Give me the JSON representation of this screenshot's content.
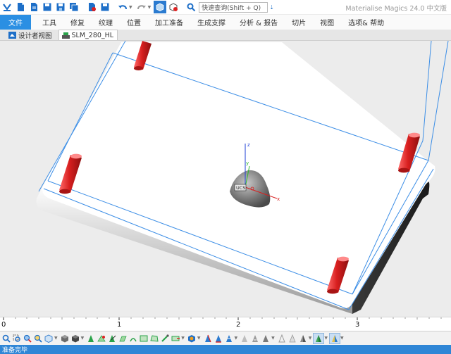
{
  "app": {
    "title": "Materialise Magics 24.0 中文版"
  },
  "quick_access": {
    "search_placeholder": "快速查询(Shift + Q)",
    "icons": [
      "magics-logo-icon",
      "new-file-icon",
      "open-file-icon",
      "save-icon",
      "save-as-icon",
      "save-all-icon",
      "import-icon",
      "undo-icon",
      "redo-icon",
      "view-3d-icon",
      "reset-view-icon",
      "settings-icon"
    ]
  },
  "menu": {
    "file": "文件",
    "items": [
      "工具",
      "修复",
      "纹理",
      "位置",
      "加工准备",
      "生成支撑",
      "分析 & 报告",
      "切片",
      "视图",
      "选项& 帮助"
    ]
  },
  "tabs": [
    {
      "label": "设计者视图"
    },
    {
      "label": "SLM_280_HL"
    }
  ],
  "viewport": {
    "axes": {
      "x": "x",
      "y": "y",
      "z": "z",
      "ucs": "UCS"
    },
    "colors": {
      "background": "#ececec",
      "platform": "#ffffff",
      "frame": "#3c8ee6",
      "pins": "#d81f1f",
      "part": "#7a7a7a"
    }
  },
  "ruler": {
    "ticks": [
      "0",
      "1",
      "2",
      "3"
    ]
  },
  "bottom_toolbar": {
    "icons": [
      "zoom-icon",
      "zoom-window-icon",
      "zoom-fit-icon",
      "zoom-selection-icon",
      "view-cube-icon",
      "shaded-cube-icon",
      "rotate-view-icon",
      "move-view-icon",
      "mark-triangle-icon",
      "mark-surface-icon",
      "mark-shell-icon",
      "mark-plane-icon",
      "mark-contour-icon",
      "select-window-icon",
      "select-poly-icon",
      "select-brush-icon",
      "measure-icon",
      "triangles-icon",
      "bad-edges-icon",
      "flipped-icon",
      "overlap-icon",
      "shells-icon",
      "noise-icon",
      "shade-icon",
      "wire-icon",
      "points-icon",
      "solid-icon",
      "transparent-icon"
    ]
  },
  "status": {
    "text": "准备完毕"
  }
}
